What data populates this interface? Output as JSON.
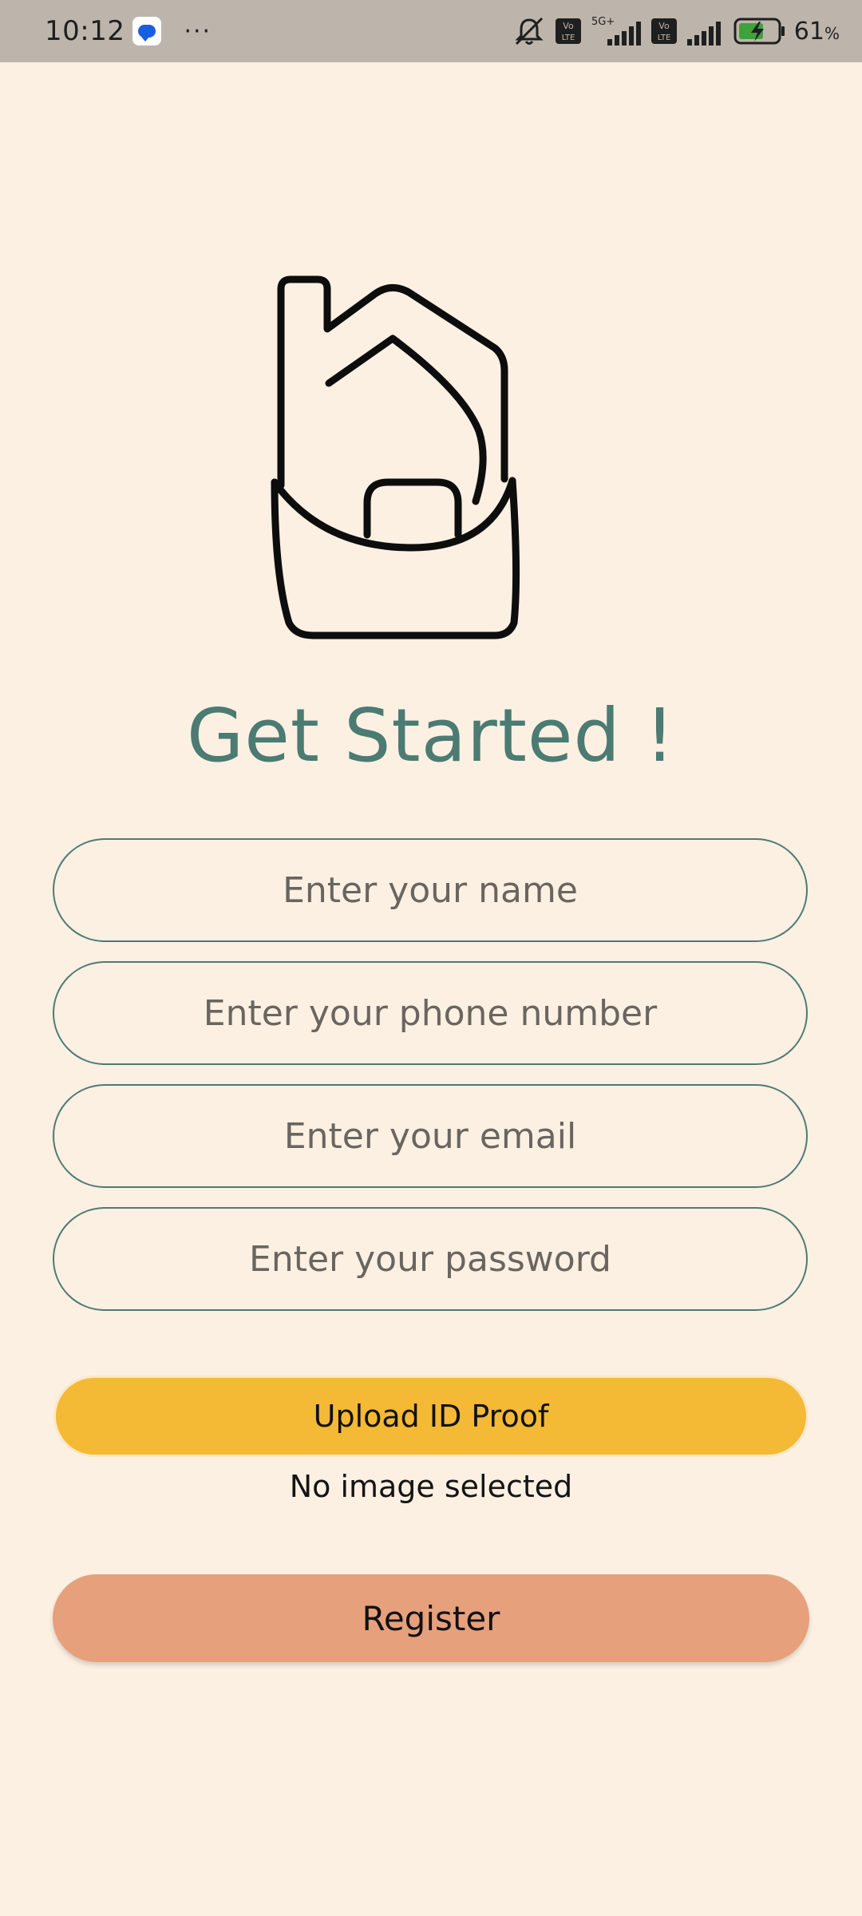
{
  "status_bar": {
    "time": "10:12",
    "dots": "···",
    "network_label": "5G+",
    "volte_label": "Vo LTE",
    "battery_percent": "61",
    "battery_unit": "%"
  },
  "title": "Get Started !",
  "form": {
    "name_placeholder": "Enter your name",
    "phone_placeholder": "Enter your phone number",
    "email_placeholder": "Enter your email",
    "password_placeholder": "Enter your password",
    "name_value": "",
    "phone_value": "",
    "email_value": "",
    "password_value": ""
  },
  "upload": {
    "button_label": "Upload ID Proof",
    "status_text": "No image selected"
  },
  "register": {
    "button_label": "Register"
  },
  "colors": {
    "background": "#fcf0e3",
    "title": "#4b7b72",
    "field_border": "#4e7a72",
    "upload_button": "#f4b935",
    "register_button": "#e7a07c",
    "status_bar": "#bdb5ac"
  },
  "icons": {
    "logo": "house-icon",
    "mute": "bell-off-icon",
    "signal": "signal-bars-icon",
    "battery": "battery-charging-icon"
  }
}
